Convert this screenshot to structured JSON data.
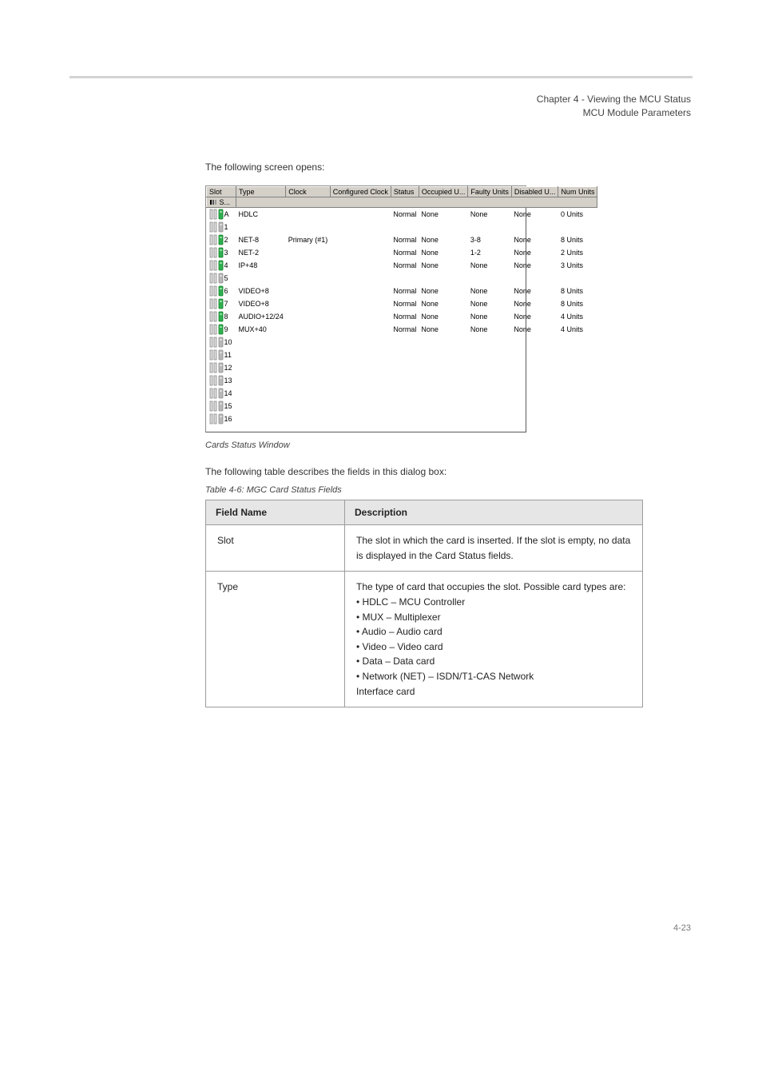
{
  "header": {
    "chapter": "Chapter 4 - Viewing the MCU Status",
    "section": "MCU Module Parameters"
  },
  "intro": "The following screen opens:",
  "figure_caption": "Cards Status Window",
  "fields_intro": "The following table describes the fields in this dialog box:",
  "table_caption": "Table 4-6: MGC Card Status Fields",
  "fields_table": {
    "head": {
      "field": "Field Name",
      "desc": "Description"
    },
    "rows": [
      {
        "field": "Slot",
        "desc": "The slot in which the card is inserted. If the slot is empty, no data is displayed in the Card Status fields."
      },
      {
        "field": "Type",
        "desc": "The type of card that occupies the slot. Possible card types are:\n•  HDLC – MCU Controller\n•  MUX – Multiplexer\n•  Audio – Audio card\n•  Video – Video card\n•  Data – Data card\n•  Network (NET) – ISDN/T1-CAS Network\n    Interface card"
      }
    ]
  },
  "slots": {
    "columns": {
      "slot": "Slot",
      "type": "Type",
      "clock": "Clock",
      "configured_clock": "Configured Clock",
      "status": "Status",
      "occupied": "Occupied U...",
      "faulty": "Faulty Units",
      "disabled": "Disabled U...",
      "num": "Num Units"
    },
    "sort_label": "S...",
    "rows": [
      {
        "slot": "A",
        "icon": "green",
        "type": "HDLC",
        "clock": "",
        "status": "Normal",
        "occupied": "None",
        "faulty": "None",
        "disabled": "None",
        "num": "0  Units"
      },
      {
        "slot": "1",
        "icon": "gray",
        "type": "",
        "clock": "",
        "status": "",
        "occupied": "",
        "faulty": "",
        "disabled": "",
        "num": ""
      },
      {
        "slot": "2",
        "icon": "green",
        "type": "NET-8",
        "clock": "Primary (#1)",
        "status": "Normal",
        "occupied": "None",
        "faulty": "3-8",
        "disabled": "None",
        "num": "8  Units"
      },
      {
        "slot": "3",
        "icon": "green",
        "type": "NET-2",
        "clock": "",
        "status": "Normal",
        "occupied": "None",
        "faulty": "1-2",
        "disabled": "None",
        "num": "2  Units"
      },
      {
        "slot": "4",
        "icon": "green",
        "type": "IP+48",
        "clock": "",
        "status": "Normal",
        "occupied": "None",
        "faulty": "None",
        "disabled": "None",
        "num": "3  Units"
      },
      {
        "slot": "5",
        "icon": "gray",
        "type": "",
        "clock": "",
        "status": "",
        "occupied": "",
        "faulty": "",
        "disabled": "",
        "num": ""
      },
      {
        "slot": "6",
        "icon": "green",
        "type": "VIDEO+8",
        "clock": "",
        "status": "Normal",
        "occupied": "None",
        "faulty": "None",
        "disabled": "None",
        "num": "8  Units"
      },
      {
        "slot": "7",
        "icon": "green",
        "type": "VIDEO+8",
        "clock": "",
        "status": "Normal",
        "occupied": "None",
        "faulty": "None",
        "disabled": "None",
        "num": "8  Units"
      },
      {
        "slot": "8",
        "icon": "green",
        "type": "AUDIO+12/24",
        "clock": "",
        "status": "Normal",
        "occupied": "None",
        "faulty": "None",
        "disabled": "None",
        "num": "4  Units"
      },
      {
        "slot": "9",
        "icon": "green",
        "type": "MUX+40",
        "clock": "",
        "status": "Normal",
        "occupied": "None",
        "faulty": "None",
        "disabled": "None",
        "num": "4  Units"
      },
      {
        "slot": "10",
        "icon": "gray",
        "type": "",
        "clock": "",
        "status": "",
        "occupied": "",
        "faulty": "",
        "disabled": "",
        "num": ""
      },
      {
        "slot": "11",
        "icon": "gray",
        "type": "",
        "clock": "",
        "status": "",
        "occupied": "",
        "faulty": "",
        "disabled": "",
        "num": ""
      },
      {
        "slot": "12",
        "icon": "gray",
        "type": "",
        "clock": "",
        "status": "",
        "occupied": "",
        "faulty": "",
        "disabled": "",
        "num": ""
      },
      {
        "slot": "13",
        "icon": "gray",
        "type": "",
        "clock": "",
        "status": "",
        "occupied": "",
        "faulty": "",
        "disabled": "",
        "num": ""
      },
      {
        "slot": "14",
        "icon": "gray",
        "type": "",
        "clock": "",
        "status": "",
        "occupied": "",
        "faulty": "",
        "disabled": "",
        "num": ""
      },
      {
        "slot": "15",
        "icon": "gray",
        "type": "",
        "clock": "",
        "status": "",
        "occupied": "",
        "faulty": "",
        "disabled": "",
        "num": ""
      },
      {
        "slot": "16",
        "icon": "gray",
        "type": "",
        "clock": "",
        "status": "",
        "occupied": "",
        "faulty": "",
        "disabled": "",
        "num": ""
      }
    ]
  },
  "footer": {
    "page": "4-23"
  }
}
